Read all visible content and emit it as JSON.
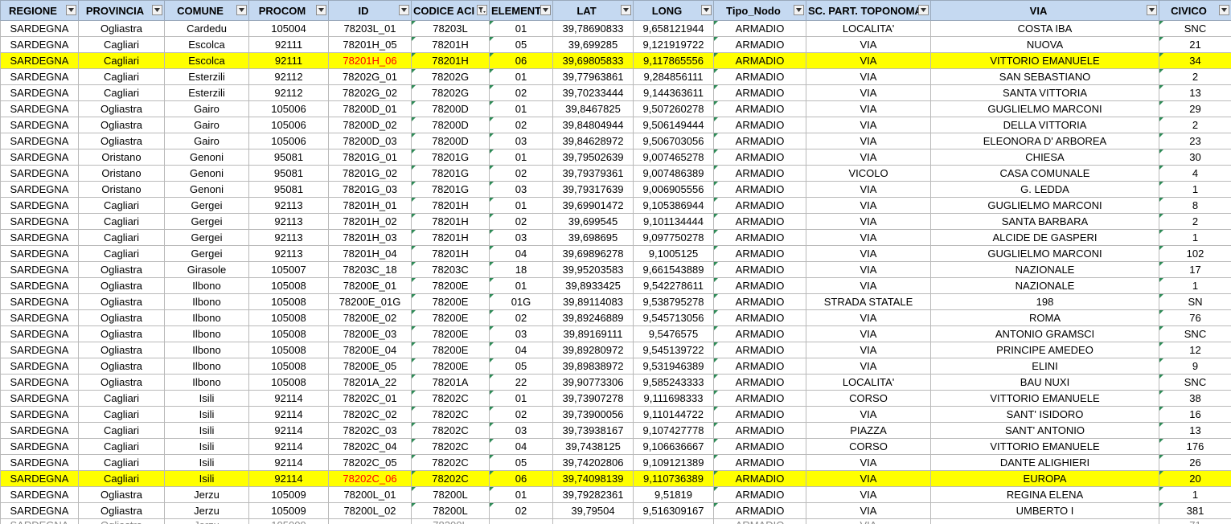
{
  "columns": [
    {
      "key": "regione",
      "label": "REGIONE",
      "width": 97,
      "filter": "dropdown"
    },
    {
      "key": "provincia",
      "label": "PROVINCIA",
      "width": 107,
      "filter": "dropdown"
    },
    {
      "key": "comune",
      "label": "COMUNE",
      "width": 105,
      "filter": "dropdown"
    },
    {
      "key": "procom",
      "label": "PROCOM",
      "width": 99,
      "filter": "dropdown"
    },
    {
      "key": "id",
      "label": "ID",
      "width": 103,
      "filter": "dropdown"
    },
    {
      "key": "codice",
      "label": "CODICE ACI",
      "width": 97,
      "filter": "filtered"
    },
    {
      "key": "elemento",
      "label": "ELEMENTO",
      "width": 79,
      "filter": "dropdown"
    },
    {
      "key": "lat",
      "label": "LAT",
      "width": 100,
      "filter": "dropdown"
    },
    {
      "key": "long",
      "label": "LONG",
      "width": 100,
      "filter": "dropdown"
    },
    {
      "key": "tipo",
      "label": "Tipo_Nodo",
      "width": 115,
      "filter": "dropdown"
    },
    {
      "key": "topo",
      "label": "SC. PART. TOPONOMA",
      "width": 155,
      "filter": "dropdown"
    },
    {
      "key": "via",
      "label": "VIA",
      "width": 284,
      "filter": "dropdown"
    },
    {
      "key": "civico",
      "label": "CIVICO",
      "width": 90,
      "filter": "dropdown"
    }
  ],
  "rows": [
    {
      "cells": [
        "SARDEGNA",
        "Ogliastra",
        "Cardedu",
        "105004",
        "78203L_01",
        "78203L",
        "01",
        "39,78690833",
        "9,658121944",
        "ARMADIO",
        "LOCALITA'",
        "COSTA IBA",
        "SNC"
      ]
    },
    {
      "cells": [
        "SARDEGNA",
        "Cagliari",
        "Escolca",
        "92111",
        "78201H_05",
        "78201H",
        "05",
        "39,699285",
        "9,121919722",
        "ARMADIO",
        "VIA",
        "NUOVA",
        "21"
      ]
    },
    {
      "cells": [
        "SARDEGNA",
        "Cagliari",
        "Escolca",
        "92111",
        "78201H_06",
        "78201H",
        "06",
        "39,69805833",
        "9,117865556",
        "ARMADIO",
        "VIA",
        "VITTORIO EMANUELE",
        "34"
      ],
      "highlight": true
    },
    {
      "cells": [
        "SARDEGNA",
        "Cagliari",
        "Esterzili",
        "92112",
        "78202G_01",
        "78202G",
        "01",
        "39,77963861",
        "9,284856111",
        "ARMADIO",
        "VIA",
        "SAN SEBASTIANO",
        "2"
      ]
    },
    {
      "cells": [
        "SARDEGNA",
        "Cagliari",
        "Esterzili",
        "92112",
        "78202G_02",
        "78202G",
        "02",
        "39,70233444",
        "9,144363611",
        "ARMADIO",
        "VIA",
        "SANTA VITTORIA",
        "13"
      ]
    },
    {
      "cells": [
        "SARDEGNA",
        "Ogliastra",
        "Gairo",
        "105006",
        "78200D_01",
        "78200D",
        "01",
        "39,8467825",
        "9,507260278",
        "ARMADIO",
        "VIA",
        "GUGLIELMO MARCONI",
        "29"
      ]
    },
    {
      "cells": [
        "SARDEGNA",
        "Ogliastra",
        "Gairo",
        "105006",
        "78200D_02",
        "78200D",
        "02",
        "39,84804944",
        "9,506149444",
        "ARMADIO",
        "VIA",
        "DELLA VITTORIA",
        "2"
      ]
    },
    {
      "cells": [
        "SARDEGNA",
        "Ogliastra",
        "Gairo",
        "105006",
        "78200D_03",
        "78200D",
        "03",
        "39,84628972",
        "9,506703056",
        "ARMADIO",
        "VIA",
        "ELEONORA D' ARBOREA",
        "23"
      ]
    },
    {
      "cells": [
        "SARDEGNA",
        "Oristano",
        "Genoni",
        "95081",
        "78201G_01",
        "78201G",
        "01",
        "39,79502639",
        "9,007465278",
        "ARMADIO",
        "VIA",
        "CHIESA",
        "30"
      ]
    },
    {
      "cells": [
        "SARDEGNA",
        "Oristano",
        "Genoni",
        "95081",
        "78201G_02",
        "78201G",
        "02",
        "39,79379361",
        "9,007486389",
        "ARMADIO",
        "VICOLO",
        "CASA COMUNALE",
        "4"
      ]
    },
    {
      "cells": [
        "SARDEGNA",
        "Oristano",
        "Genoni",
        "95081",
        "78201G_03",
        "78201G",
        "03",
        "39,79317639",
        "9,006905556",
        "ARMADIO",
        "VIA",
        "G. LEDDA",
        "1"
      ]
    },
    {
      "cells": [
        "SARDEGNA",
        "Cagliari",
        "Gergei",
        "92113",
        "78201H_01",
        "78201H",
        "01",
        "39,69901472",
        "9,105386944",
        "ARMADIO",
        "VIA",
        "GUGLIELMO MARCONI",
        "8"
      ]
    },
    {
      "cells": [
        "SARDEGNA",
        "Cagliari",
        "Gergei",
        "92113",
        "78201H_02",
        "78201H",
        "02",
        "39,699545",
        "9,101134444",
        "ARMADIO",
        "VIA",
        "SANTA BARBARA",
        "2"
      ]
    },
    {
      "cells": [
        "SARDEGNA",
        "Cagliari",
        "Gergei",
        "92113",
        "78201H_03",
        "78201H",
        "03",
        "39,698695",
        "9,097750278",
        "ARMADIO",
        "VIA",
        "ALCIDE DE GASPERI",
        "1"
      ]
    },
    {
      "cells": [
        "SARDEGNA",
        "Cagliari",
        "Gergei",
        "92113",
        "78201H_04",
        "78201H",
        "04",
        "39,69896278",
        "9,1005125",
        "ARMADIO",
        "VIA",
        "GUGLIELMO MARCONI",
        "102"
      ]
    },
    {
      "cells": [
        "SARDEGNA",
        "Ogliastra",
        "Girasole",
        "105007",
        "78203C_18",
        "78203C",
        "18",
        "39,95203583",
        "9,661543889",
        "ARMADIO",
        "VIA",
        "NAZIONALE",
        "17"
      ]
    },
    {
      "cells": [
        "SARDEGNA",
        "Ogliastra",
        "Ilbono",
        "105008",
        "78200E_01",
        "78200E",
        "01",
        "39,8933425",
        "9,542278611",
        "ARMADIO",
        "VIA",
        "NAZIONALE",
        "1"
      ]
    },
    {
      "cells": [
        "SARDEGNA",
        "Ogliastra",
        "Ilbono",
        "105008",
        "78200E_01G",
        "78200E",
        "01G",
        "39,89114083",
        "9,538795278",
        "ARMADIO",
        "STRADA STATALE",
        "198",
        "SN"
      ]
    },
    {
      "cells": [
        "SARDEGNA",
        "Ogliastra",
        "Ilbono",
        "105008",
        "78200E_02",
        "78200E",
        "02",
        "39,89246889",
        "9,545713056",
        "ARMADIO",
        "VIA",
        "ROMA",
        "76"
      ]
    },
    {
      "cells": [
        "SARDEGNA",
        "Ogliastra",
        "Ilbono",
        "105008",
        "78200E_03",
        "78200E",
        "03",
        "39,89169111",
        "9,5476575",
        "ARMADIO",
        "VIA",
        "ANTONIO GRAMSCI",
        "SNC"
      ]
    },
    {
      "cells": [
        "SARDEGNA",
        "Ogliastra",
        "Ilbono",
        "105008",
        "78200E_04",
        "78200E",
        "04",
        "39,89280972",
        "9,545139722",
        "ARMADIO",
        "VIA",
        "PRINCIPE AMEDEO",
        "12"
      ]
    },
    {
      "cells": [
        "SARDEGNA",
        "Ogliastra",
        "Ilbono",
        "105008",
        "78200E_05",
        "78200E",
        "05",
        "39,89838972",
        "9,531946389",
        "ARMADIO",
        "VIA",
        "ELINI",
        "9"
      ]
    },
    {
      "cells": [
        "SARDEGNA",
        "Ogliastra",
        "Ilbono",
        "105008",
        "78201A_22",
        "78201A",
        "22",
        "39,90773306",
        "9,585243333",
        "ARMADIO",
        "LOCALITA'",
        "BAU NUXI",
        "SNC"
      ]
    },
    {
      "cells": [
        "SARDEGNA",
        "Cagliari",
        "Isili",
        "92114",
        "78202C_01",
        "78202C",
        "01",
        "39,73907278",
        "9,111698333",
        "ARMADIO",
        "CORSO",
        "VITTORIO EMANUELE",
        "38"
      ]
    },
    {
      "cells": [
        "SARDEGNA",
        "Cagliari",
        "Isili",
        "92114",
        "78202C_02",
        "78202C",
        "02",
        "39,73900056",
        "9,110144722",
        "ARMADIO",
        "VIA",
        "SANT' ISIDORO",
        "16"
      ]
    },
    {
      "cells": [
        "SARDEGNA",
        "Cagliari",
        "Isili",
        "92114",
        "78202C_03",
        "78202C",
        "03",
        "39,73938167",
        "9,107427778",
        "ARMADIO",
        "PIAZZA",
        "SANT' ANTONIO",
        "13"
      ]
    },
    {
      "cells": [
        "SARDEGNA",
        "Cagliari",
        "Isili",
        "92114",
        "78202C_04",
        "78202C",
        "04",
        "39,7438125",
        "9,106636667",
        "ARMADIO",
        "CORSO",
        "VITTORIO EMANUELE",
        "176"
      ]
    },
    {
      "cells": [
        "SARDEGNA",
        "Cagliari",
        "Isili",
        "92114",
        "78202C_05",
        "78202C",
        "05",
        "39,74202806",
        "9,109121389",
        "ARMADIO",
        "VIA",
        "DANTE ALIGHIERI",
        "26"
      ]
    },
    {
      "cells": [
        "SARDEGNA",
        "Cagliari",
        "Isili",
        "92114",
        "78202C_06",
        "78202C",
        "06",
        "39,74098139",
        "9,110736389",
        "ARMADIO",
        "VIA",
        "EUROPA",
        "20"
      ],
      "highlight": true
    },
    {
      "cells": [
        "SARDEGNA",
        "Ogliastra",
        "Jerzu",
        "105009",
        "78200L_01",
        "78200L",
        "01",
        "39,79282361",
        "9,51819",
        "ARMADIO",
        "VIA",
        "REGINA ELENA",
        "1"
      ]
    },
    {
      "cells": [
        "SARDEGNA",
        "Ogliastra",
        "Jerzu",
        "105009",
        "78200L_02",
        "78200L",
        "02",
        "39,79504",
        "9,516309167",
        "ARMADIO",
        "VIA",
        "UMBERTO I",
        "381"
      ]
    }
  ],
  "partial_row": [
    "SARDEGNA",
    "Ogliastra",
    "Jerzu",
    "105009",
    "",
    "78200L",
    "",
    "",
    "",
    "ARMADIO",
    "VIA",
    "",
    "71"
  ],
  "colors": {
    "header_bg": "#c5d9f1",
    "highlight_bg": "#ffff00",
    "highlight_id_text": "#ff0000",
    "cell_marker": "#2e8b57",
    "gridline": "#b9b9b9"
  },
  "icons": {
    "filter_dropdown": "dropdown-arrow-icon",
    "filter_active": "funnel-filter-icon"
  }
}
